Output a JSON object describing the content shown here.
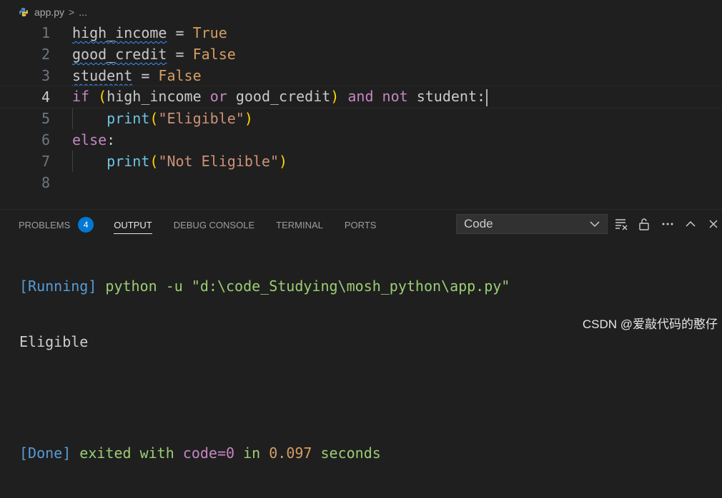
{
  "breadcrumb": {
    "file": "app.py",
    "separator": ">",
    "ellipsis": "..."
  },
  "editor": {
    "active_line": 4,
    "line_numbers": [
      "1",
      "2",
      "3",
      "4",
      "5",
      "6",
      "7",
      "8"
    ],
    "lines": [
      {
        "var": "high_income",
        "op": " = ",
        "value": "True"
      },
      {
        "var": "good_credit",
        "op": " = ",
        "value": "False"
      },
      {
        "var": "student",
        "op": " = ",
        "value": "False"
      },
      {
        "kw_if": "if",
        "open": " (",
        "a": "high_income",
        "or": "or",
        "b": "good_credit",
        "close": ")",
        "and": "and",
        "not": "not",
        "c": "student",
        "colon": ":"
      },
      {
        "indent": "    ",
        "fn": "print",
        "open": "(",
        "str": "\"Eligible\"",
        "close": ")"
      },
      {
        "kw": "else",
        "colon": ":"
      },
      {
        "indent": "    ",
        "fn": "print",
        "open": "(",
        "str": "\"Not Eligible\"",
        "close": ")"
      },
      {}
    ]
  },
  "panel": {
    "tabs": [
      {
        "label": "PROBLEMS",
        "badge": "4"
      },
      {
        "label": "OUTPUT"
      },
      {
        "label": "DEBUG CONSOLE"
      },
      {
        "label": "TERMINAL"
      },
      {
        "label": "PORTS"
      }
    ],
    "active_tab": "OUTPUT",
    "output_channel": "Code",
    "output": {
      "running_tag": "[Running]",
      "running_cmd": "python -u \"d:\\code_Studying\\mosh_python\\app.py\"",
      "result": "Eligible",
      "done_tag": "[Done]",
      "done_text_1": "exited with",
      "done_code": "code=0",
      "done_text_2": "in",
      "done_time": "0.097",
      "done_text_3": "seconds"
    }
  },
  "watermark": "CSDN @爱敲代码的憨仔",
  "colors": {
    "background": "#1f1f1f",
    "keyword": "#c586c0",
    "boolean": "#d69d62",
    "function": "#6fc4e3",
    "string": "#ce9178",
    "badge": "#0078d4"
  }
}
